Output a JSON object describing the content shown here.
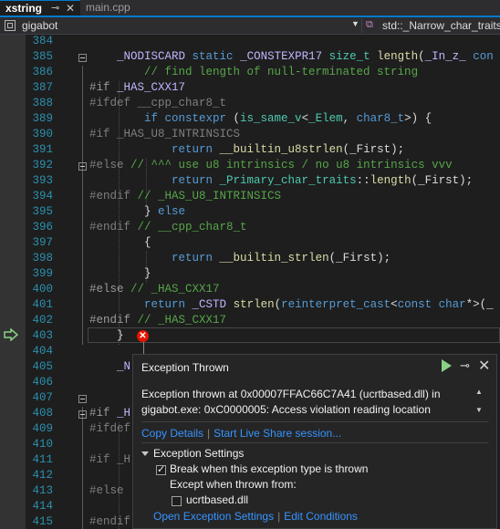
{
  "tabs": [
    {
      "label": "xstring",
      "active": true
    },
    {
      "label": "main.cpp",
      "active": false
    }
  ],
  "tab_pin_glyph": "⊸",
  "tab_close_glyph": "✕",
  "navbar": {
    "project": "gigabot",
    "scope": "std::_Narrow_char_traits"
  },
  "editor": {
    "lines": [
      {
        "n": "384",
        "html": ""
      },
      {
        "n": "385",
        "html": "    <span class='mac'>_NODISCARD</span> <span class='kw'>static</span> <span class='mac'>_CONSTEXPR17</span> <span class='ty'>size_t</span> <span class='fn'>length</span>(<span class='mac'>_In_z_</span> <span class='kw'>con</span>"
      },
      {
        "n": "386",
        "html": "        <span class='cm'>// find length of null-terminated string</span>"
      },
      {
        "n": "387",
        "html": "<span class='pp'>#if</span> <span class='mac'>_HAS_CXX17</span>"
      },
      {
        "n": "388",
        "html": "<span class='ppdim'>#ifdef __cpp_char8_t</span>"
      },
      {
        "n": "389",
        "html": "        <span class='kw'>if constexpr</span> (<span class='ty'>is_same_v</span>&lt;<span class='ty'>_Elem</span>, <span class='kw'>char8_t</span>&gt;) {"
      },
      {
        "n": "390",
        "html": "<span class='ppdim'>#if _HAS_U8_INTRINSICS</span>"
      },
      {
        "n": "391",
        "html": "            <span class='kw'>return</span> <span class='fn'>__builtin_u8strlen</span>(_First);"
      },
      {
        "n": "392",
        "html": "<span class='ppdim'>#else</span> <span class='cm'>// ^^^ use u8 intrinsics / no u8 intrinsics vvv</span>"
      },
      {
        "n": "393",
        "html": "            <span class='kw'>return</span> <span class='ty'>_Primary_char_traits</span>::<span class='fn'>length</span>(_First);"
      },
      {
        "n": "394",
        "html": "<span class='ppdim'>#endif</span> <span class='cm'>// _HAS_U8_INTRINSICS</span>"
      },
      {
        "n": "395",
        "html": "        } <span class='kw'>else</span>"
      },
      {
        "n": "396",
        "html": "<span class='ppdim'>#endif</span> <span class='cm'>// __cpp_char8_t</span>"
      },
      {
        "n": "397",
        "html": "        {"
      },
      {
        "n": "398",
        "html": "            <span class='kw'>return</span> <span class='fn'>__builtin_strlen</span>(_First);"
      },
      {
        "n": "399",
        "html": "        }"
      },
      {
        "n": "400",
        "html": "<span class='pp'>#else</span> <span class='cm'>// _HAS_CXX17</span>"
      },
      {
        "n": "401",
        "html": "        <span class='kw'>return</span> <span class='mac'>_CSTD</span> <span class='fn'>strlen</span>(<span class='kw'>reinterpret_cast</span>&lt;<span class='kw'>const char</span>*&gt;(_"
      },
      {
        "n": "402",
        "html": "<span class='pp'>#endif</span> <span class='cm'>// _HAS_CXX17</span>"
      },
      {
        "n": "403",
        "html": "    }"
      },
      {
        "n": "404",
        "html": ""
      },
      {
        "n": "405",
        "html": "    <span class='mac'>_N</span>"
      },
      {
        "n": "406",
        "html": ""
      },
      {
        "n": "407",
        "html": ""
      },
      {
        "n": "408",
        "html": "<span class='pp'>#if</span> <span class='mac'>_H</span>"
      },
      {
        "n": "409",
        "html": "<span class='ppdim'>#ifdef</span>"
      },
      {
        "n": "410",
        "html": ""
      },
      {
        "n": "411",
        "html": "<span class='ppdim'>#if _H</span>"
      },
      {
        "n": "412",
        "html": ""
      },
      {
        "n": "413",
        "html": "<span class='ppdim'>#else</span>"
      },
      {
        "n": "414",
        "html": ""
      },
      {
        "n": "415",
        "html": "<span class='ppdim'>#endif</span>"
      }
    ]
  },
  "exception": {
    "title": "Exception Thrown",
    "message": "Exception thrown at 0x00007FFAC66C7A41 (ucrtbased.dll) in gigabot.exe: 0xC0000005: Access violation reading location",
    "copy_details": "Copy Details",
    "live_share": "Start Live Share session...",
    "settings_header": "Exception Settings",
    "break_option": "Break when this exception type is thrown",
    "break_checked": true,
    "except_label": "Except when thrown from:",
    "module_option": "ucrtbased.dll",
    "module_checked": false,
    "open_settings": "Open Exception Settings",
    "edit_conditions": "Edit Conditions",
    "close_glyph": "✕",
    "pin_glyph": "⊸",
    "error_glyph": "✕"
  },
  "colors": {
    "accent": "#007acc",
    "link": "#3794ff",
    "error": "#e51400",
    "continue": "#89d185"
  }
}
